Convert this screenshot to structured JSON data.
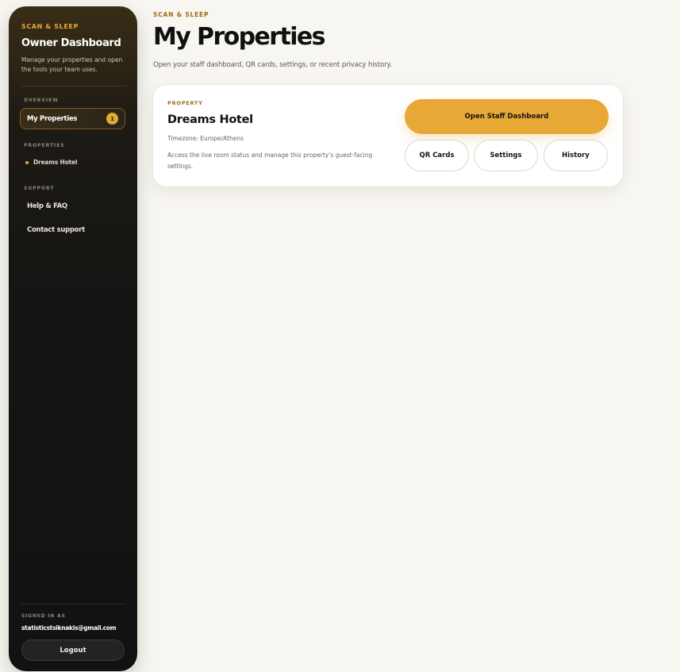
{
  "sidebar": {
    "brand": "SCAN & SLEEP",
    "title": "Owner Dashboard",
    "description": "Manage your properties and open the tools your team uses.",
    "sections": {
      "overview": "OVERVIEW",
      "properties": "PROPERTIES",
      "support": "SUPPORT"
    },
    "nav_active": {
      "label": "My Properties",
      "badge": "1"
    },
    "property_link": "Dreams Hotel",
    "support_links": [
      "Help & FAQ",
      "Contact support"
    ],
    "signed_in_label": "SIGNED IN AS",
    "signed_in_email": "statisticstsiknakis@gmail.com",
    "logout_label": "Logout"
  },
  "main": {
    "eyebrow": "SCAN & SLEEP",
    "title": "My Properties",
    "subtitle": "Open your staff dashboard, QR cards, settings, or recent privacy history."
  },
  "property_card": {
    "eyebrow": "PROPERTY",
    "name": "Dreams Hotel",
    "timezone": "Timezone: Europe/Athens",
    "description": "Access the live room status and manage this property's guest-facing settings.",
    "primary_button": "Open Staff Dashboard",
    "buttons": [
      "QR Cards",
      "Settings",
      "History"
    ]
  },
  "colors": {
    "accent": "#e7a835",
    "sidebar_bg": "#121212",
    "page_bg": "#f8f6f1",
    "eyebrow": "#9b6a12"
  }
}
